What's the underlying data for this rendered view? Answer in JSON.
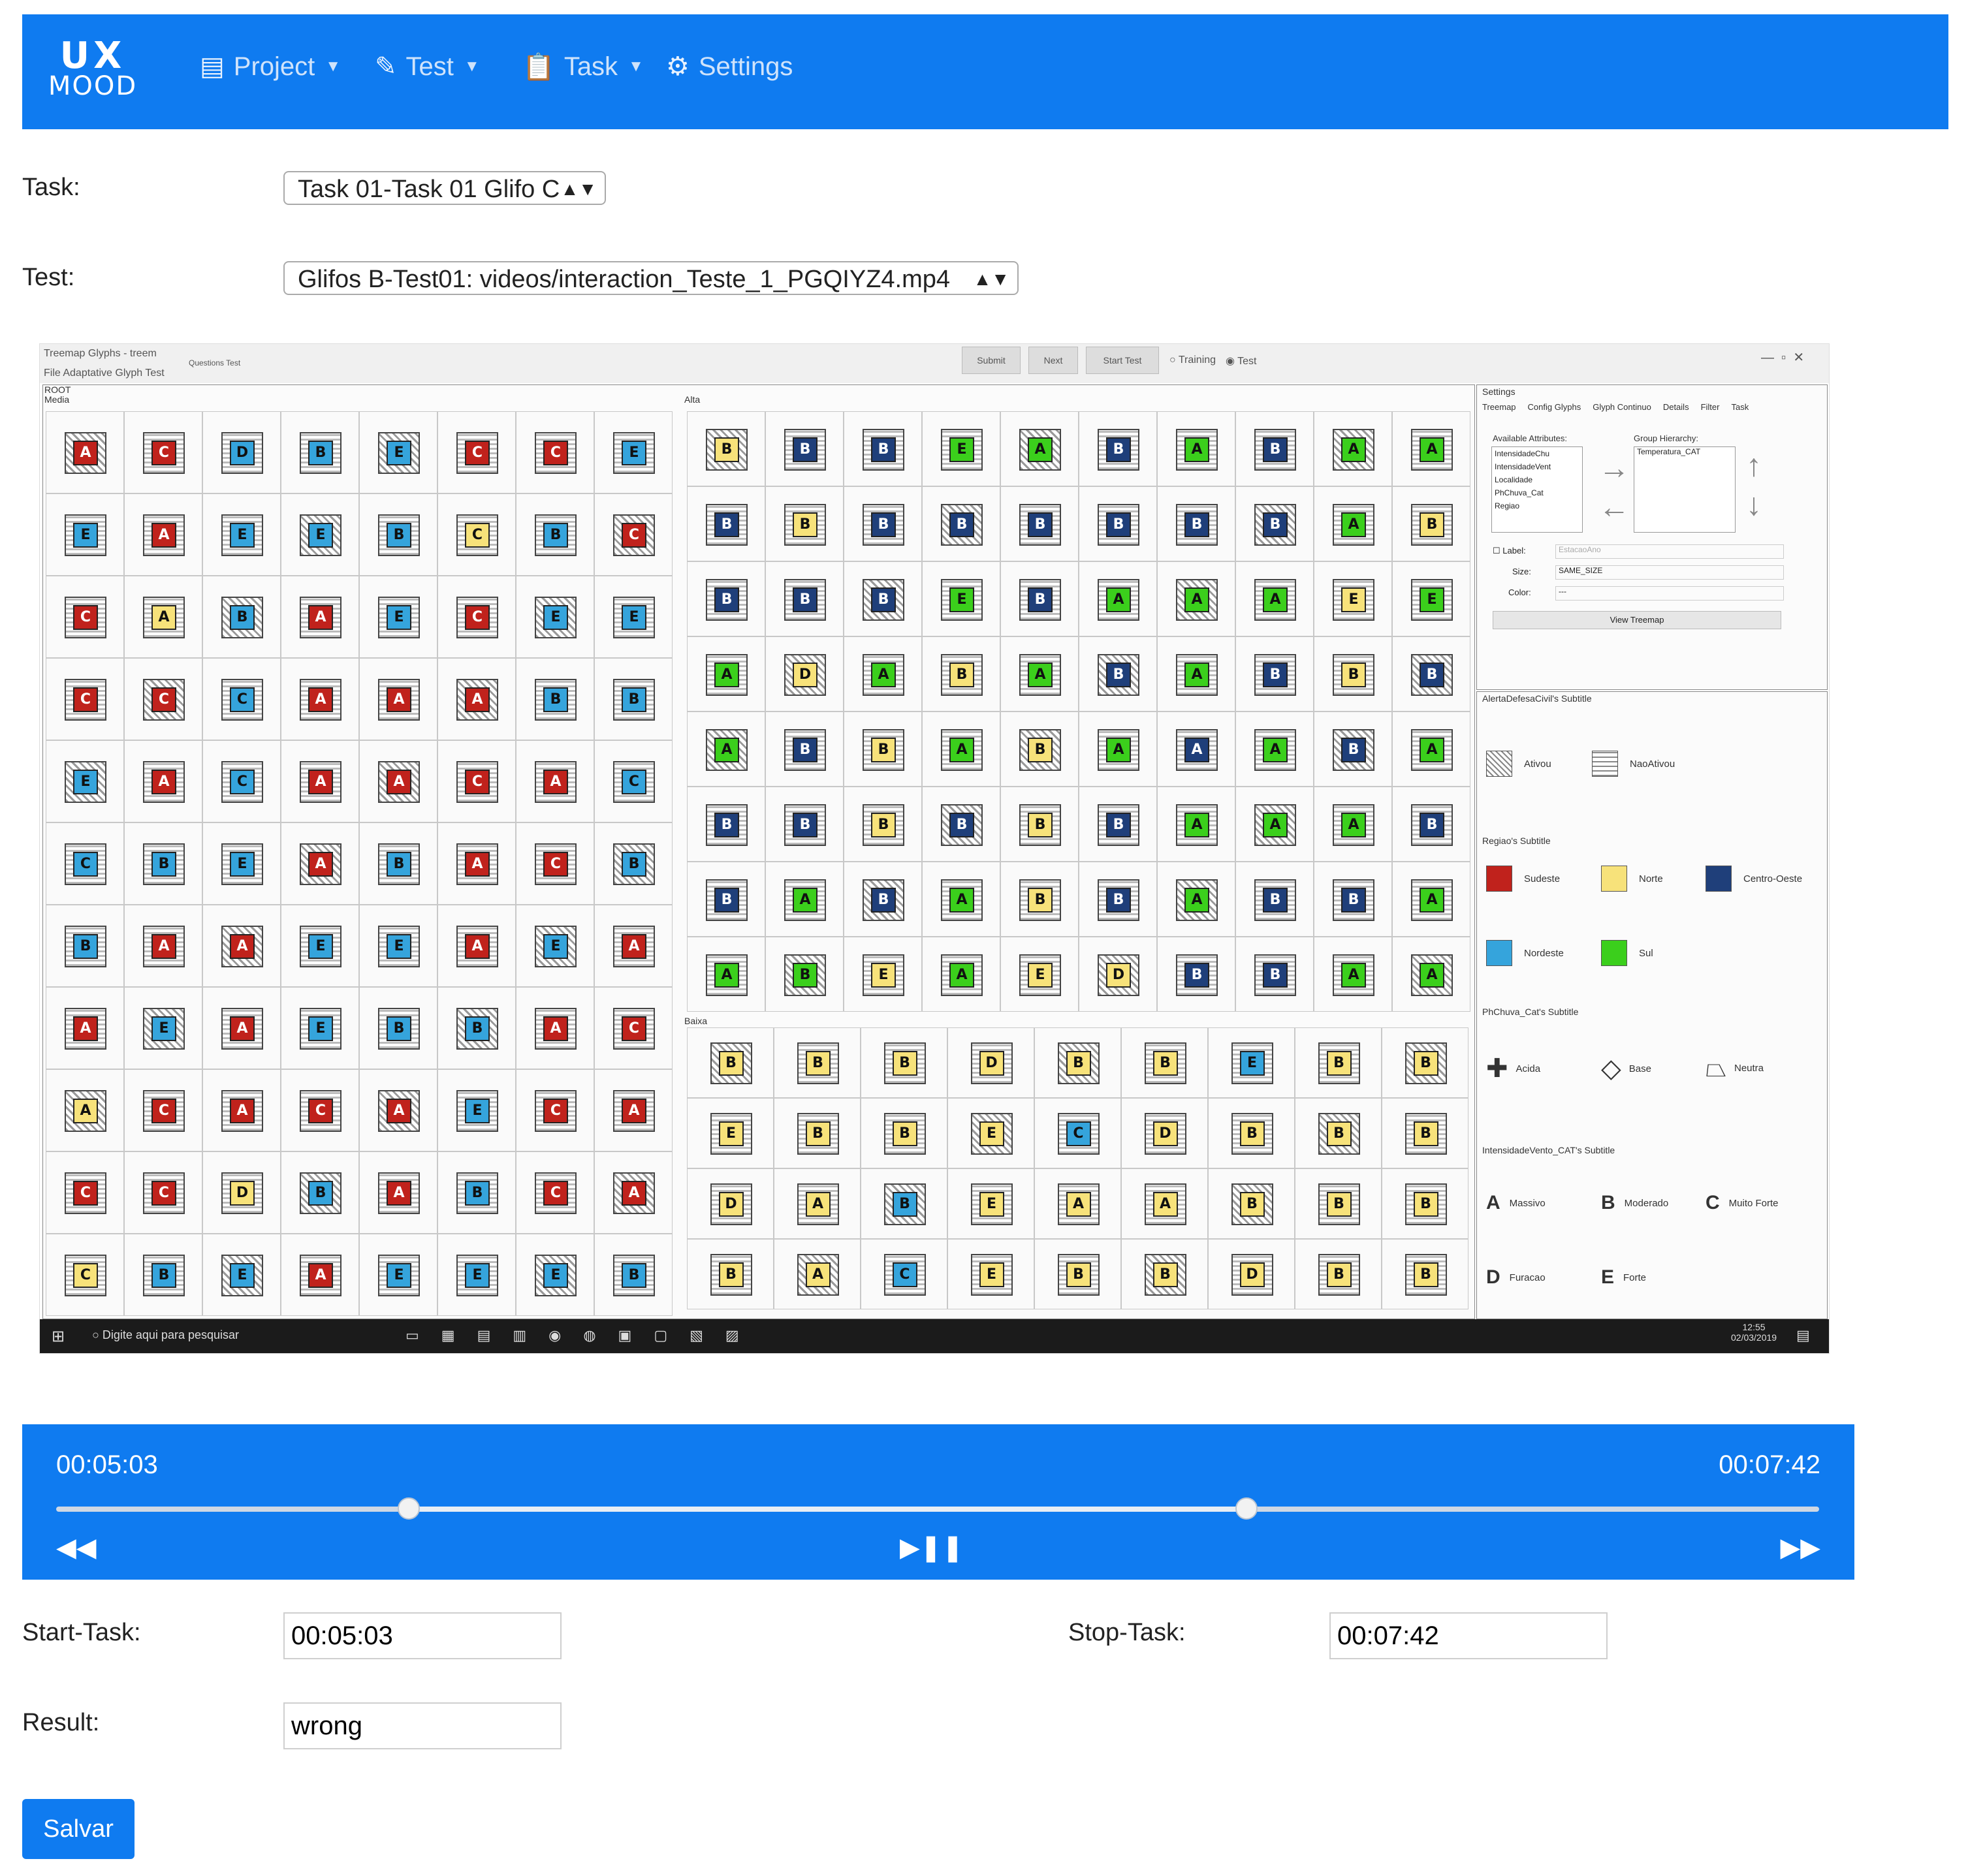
{
  "app": {
    "logo_top": "UX",
    "logo_bottom": "MOOD"
  },
  "nav": {
    "items": [
      {
        "label": "Project",
        "icon": "project-icon"
      },
      {
        "label": "Test",
        "icon": "test-icon"
      },
      {
        "label": "Task",
        "icon": "clipboard-icon"
      },
      {
        "label": "Settings",
        "icon": "gear-icon"
      }
    ]
  },
  "form": {
    "task_label": "Task:",
    "task_value": "Task 01-Task 01 Glifo C",
    "test_label": "Test:",
    "test_value": "Glifos B-Test01: videos/interaction_Teste_1_PGQIYZ4.mp4",
    "start_label": "Start-Task:",
    "start_value": "00:05:03",
    "stop_label": "Stop-Task:",
    "stop_value": "00:07:42",
    "result_label": "Result:",
    "result_value": "wrong",
    "save_label": "Salvar"
  },
  "player": {
    "start_time": "00:05:03",
    "end_time": "00:07:42",
    "range_start_fraction": 0.2,
    "range_end_fraction": 0.675,
    "rewind": "◀◀",
    "play_pause": "▶❚❚",
    "forward": "▶▶"
  },
  "video": {
    "window_title": "Treemap Glyphs - treem",
    "menu": "File  Adaptative Glyph  Test",
    "questions": "Questions Test",
    "buttons": [
      "Submit",
      "Next",
      "Start Test"
    ],
    "radio_training": "Training",
    "radio_test": "Test",
    "root_label": "ROOT",
    "groups": [
      "Media",
      "Alta",
      "Baixa"
    ],
    "settings_title": "Settings",
    "settings_tabs": [
      "Treemap",
      "Config Glyphs",
      "Glyph Continuo",
      "Details",
      "Filter",
      "Task"
    ],
    "available_attributes": "Available Attributes:",
    "attributes": [
      "IntensidadeChu",
      "IntensidadeVent",
      "Localidade",
      "PhChuva_Cat",
      "Regiao"
    ],
    "group_hierarchy": "Group Hierarchy:",
    "hierarchy_item": "Temperatura_CAT",
    "label_label": "Label:",
    "label_value": "EstacaoAno",
    "size_label": "Size:",
    "size_value": "SAME_SIZE",
    "color_label": "Color:",
    "color_value": "---",
    "view_button": "View Treemap",
    "legend1_title": "AlertaDefesaCivil's Subtitle",
    "legend1": [
      "Ativou",
      "NaoAtivou"
    ],
    "legend2_title": "Regiao's Subtitle",
    "legend2": [
      {
        "label": "Sudeste",
        "color": "#c0221c"
      },
      {
        "label": "Norte",
        "color": "#f7e27a"
      },
      {
        "label": "Centro-Oeste",
        "color": "#1f3f7a"
      },
      {
        "label": "Nordeste",
        "color": "#35a4dc"
      },
      {
        "label": "Sul",
        "color": "#3bcf1c"
      }
    ],
    "legend3_title": "PhChuva_Cat's Subtitle",
    "legend3": [
      "Acida",
      "Base",
      "Neutra"
    ],
    "legend4_title": "IntensidadeVento_CAT's Subtitle",
    "legend4": [
      {
        "key": "A",
        "label": "Massivo"
      },
      {
        "key": "B",
        "label": "Moderado"
      },
      {
        "key": "C",
        "label": "Muito Forte"
      },
      {
        "key": "D",
        "label": "Furacao"
      },
      {
        "key": "E",
        "label": "Forte"
      }
    ],
    "search_placeholder": "Digite aqui para pesquisar",
    "clock_time": "12:55",
    "clock_date": "02/03/2019",
    "media_rows": [
      [
        "A",
        "C",
        "D",
        "B",
        "E",
        "C",
        "C",
        "E"
      ],
      [
        "E",
        "A",
        "E",
        "E",
        "B",
        "C",
        "B",
        "C"
      ],
      [
        "C",
        "A",
        "B",
        "A",
        "E",
        "C",
        "E",
        "E"
      ],
      [
        "C",
        "C",
        "C",
        "A",
        "A",
        "A",
        "B",
        "B"
      ],
      [
        "E",
        "A",
        "C",
        "A",
        "A",
        "C",
        "A",
        "C"
      ],
      [
        "C",
        "B",
        "E",
        "A",
        "B",
        "A",
        "C",
        "B"
      ],
      [
        "B",
        "A",
        "A",
        "E",
        "E",
        "A",
        "E",
        "A"
      ],
      [
        "A",
        "E",
        "A",
        "E",
        "B",
        "B",
        "A",
        "C"
      ],
      [
        "A",
        "C",
        "A",
        "C",
        "A",
        "E",
        "C",
        "A"
      ],
      [
        "C",
        "C",
        "D",
        "B",
        "A",
        "B",
        "C",
        "A"
      ],
      [
        "C",
        "B",
        "E",
        "A",
        "E",
        "E",
        "E",
        "B"
      ]
    ],
    "media_colors": [
      [
        "r",
        "r",
        "b",
        "b",
        "b",
        "r",
        "r",
        "b"
      ],
      [
        "b",
        "r",
        "b",
        "b",
        "b",
        "y",
        "b",
        "r"
      ],
      [
        "r",
        "y",
        "b",
        "r",
        "b",
        "r",
        "b",
        "b"
      ],
      [
        "r",
        "r",
        "b",
        "r",
        "r",
        "r",
        "b",
        "b"
      ],
      [
        "b",
        "r",
        "b",
        "r",
        "r",
        "r",
        "r",
        "b"
      ],
      [
        "b",
        "b",
        "b",
        "r",
        "b",
        "r",
        "r",
        "b"
      ],
      [
        "b",
        "r",
        "r",
        "b",
        "b",
        "r",
        "b",
        "r"
      ],
      [
        "r",
        "b",
        "r",
        "b",
        "b",
        "b",
        "r",
        "r"
      ],
      [
        "y",
        "r",
        "r",
        "r",
        "r",
        "b",
        "r",
        "r"
      ],
      [
        "r",
        "r",
        "y",
        "b",
        "r",
        "b",
        "r",
        "r"
      ],
      [
        "y",
        "b",
        "b",
        "r",
        "b",
        "b",
        "b",
        "b"
      ]
    ],
    "alta_rows": [
      [
        "B",
        "B",
        "B",
        "E",
        "A",
        "B",
        "A",
        "B",
        "A",
        "A"
      ],
      [
        "B",
        "B",
        "B",
        "B",
        "B",
        "B",
        "B",
        "B",
        "A",
        "B"
      ],
      [
        "B",
        "B",
        "B",
        "E",
        "B",
        "A",
        "A",
        "A",
        "E",
        "E"
      ],
      [
        "A",
        "D",
        "A",
        "B",
        "A",
        "B",
        "A",
        "B",
        "B",
        "B"
      ],
      [
        "A",
        "B",
        "B",
        "A",
        "B",
        "A",
        "A",
        "A",
        "B",
        "A"
      ],
      [
        "B",
        "B",
        "B",
        "B",
        "B",
        "B",
        "A",
        "A",
        "A",
        "B"
      ],
      [
        "B",
        "A",
        "B",
        "A",
        "B",
        "B",
        "A",
        "B",
        "B",
        "A"
      ],
      [
        "A",
        "B",
        "E",
        "A",
        "E",
        "D",
        "B",
        "B",
        "A",
        "A"
      ]
    ],
    "alta_colors": [
      [
        "y",
        "n",
        "n",
        "g",
        "g",
        "n",
        "g",
        "n",
        "g",
        "g"
      ],
      [
        "n",
        "y",
        "n",
        "n",
        "n",
        "n",
        "n",
        "n",
        "g",
        "y"
      ],
      [
        "n",
        "n",
        "n",
        "g",
        "n",
        "g",
        "g",
        "g",
        "y",
        "g"
      ],
      [
        "g",
        "y",
        "g",
        "y",
        "g",
        "n",
        "g",
        "n",
        "y",
        "n"
      ],
      [
        "g",
        "n",
        "y",
        "g",
        "y",
        "g",
        "n",
        "g",
        "n",
        "g"
      ],
      [
        "n",
        "n",
        "y",
        "n",
        "y",
        "n",
        "g",
        "g",
        "g",
        "n"
      ],
      [
        "n",
        "g",
        "n",
        "g",
        "y",
        "n",
        "g",
        "n",
        "n",
        "g"
      ],
      [
        "g",
        "g",
        "y",
        "g",
        "y",
        "y",
        "n",
        "n",
        "g",
        "g"
      ]
    ],
    "baixa_rows": [
      [
        "B",
        "B",
        "B",
        "D",
        "B",
        "B",
        "E",
        "B",
        "B"
      ],
      [
        "E",
        "B",
        "B",
        "E",
        "C",
        "D",
        "B",
        "B",
        "B"
      ],
      [
        "D",
        "A",
        "B",
        "E",
        "A",
        "A",
        "B",
        "B",
        "B"
      ],
      [
        "B",
        "A",
        "C",
        "E",
        "B",
        "B",
        "D",
        "B",
        "B"
      ]
    ],
    "baixa_colors": [
      [
        "y",
        "y",
        "y",
        "y",
        "y",
        "y",
        "c",
        "y",
        "y"
      ],
      [
        "y",
        "y",
        "y",
        "y",
        "c",
        "y",
        "y",
        "y",
        "y"
      ],
      [
        "y",
        "y",
        "c",
        "y",
        "y",
        "y",
        "y",
        "y",
        "y"
      ],
      [
        "y",
        "y",
        "c",
        "y",
        "y",
        "y",
        "y",
        "y",
        "y"
      ]
    ]
  }
}
